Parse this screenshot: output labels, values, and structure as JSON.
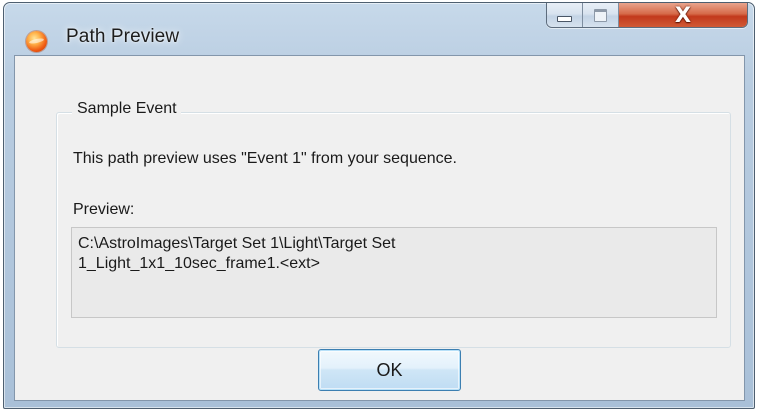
{
  "window": {
    "title": "Path Preview",
    "icon": "sequence-generator-app-icon",
    "controls": {
      "minimize_icon": "minimize-icon",
      "maximize_icon": "maximize-icon",
      "close_icon": "close-icon",
      "close_glyph": "X"
    }
  },
  "group": {
    "legend": "Sample Event",
    "description": "This path preview uses \"Event 1\" from your sequence.",
    "preview_label": "Preview:",
    "preview_value": "C:\\AstroImages\\Target Set 1\\Light\\Target Set\n1_Light_1x1_10sec_frame1.<ext>"
  },
  "buttons": {
    "ok_label": "OK"
  },
  "colors": {
    "close_button": "#c2391c",
    "ok_button_border": "#3c7fb1",
    "frame": "#b9cde1"
  }
}
